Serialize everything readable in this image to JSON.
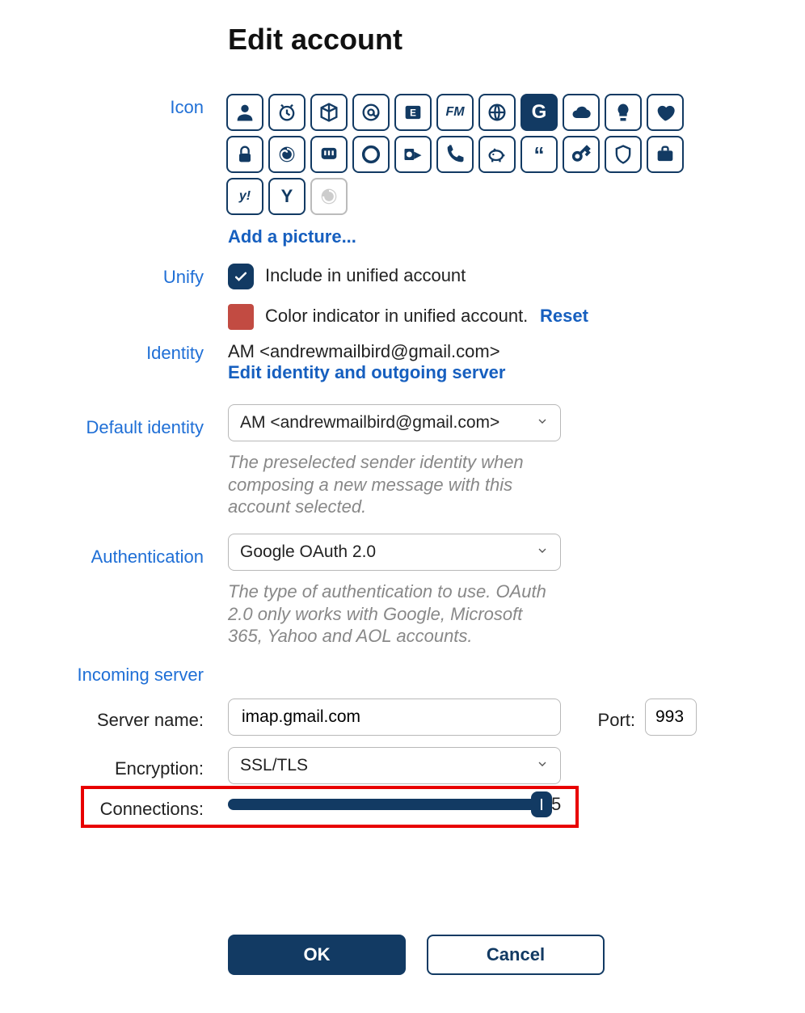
{
  "title": "Edit account",
  "labels": {
    "icon": "Icon",
    "unify": "Unify",
    "identity": "Identity",
    "defaultIdentity": "Default identity",
    "authentication": "Authentication",
    "incomingServer": "Incoming server",
    "serverName": "Server name:",
    "port": "Port:",
    "encryption": "Encryption:",
    "connections": "Connections:"
  },
  "iconPalette": {
    "addPicture": "Add a picture...",
    "selectedIndex": 8,
    "icons": [
      "person-icon",
      "clock-icon",
      "cube-icon",
      "at-icon",
      "exchange-icon",
      "fastmail-icon",
      "globe-icon",
      "google-icon",
      "google-icon-sel",
      "cloud-icon",
      "bulb-icon",
      "heart-icon",
      "lock-icon",
      "spiral-icon",
      "mastodon-icon",
      "circle-icon",
      "outlook-icon",
      "phone-icon",
      "piggy-icon",
      "quote-icon",
      "key-icon",
      "shield-icon",
      "briefcase-icon",
      "yahoo-icon",
      "y-icon",
      "disabled-icon"
    ]
  },
  "unify": {
    "checked": true,
    "includeLabel": "Include in unified account",
    "colorIndicator": "#c24b42",
    "colorLabel": "Color indicator in unified account.",
    "resetLabel": "Reset"
  },
  "identity": {
    "display": "AM <andrewmailbird@gmail.com>",
    "editLink": "Edit identity and outgoing server"
  },
  "defaultIdentity": {
    "value": "AM <andrewmailbird@gmail.com>",
    "hint": "The preselected sender identity when composing a new message with this account selected."
  },
  "authentication": {
    "value": "Google OAuth 2.0",
    "hint": "The type of authentication to use. OAuth 2.0 only works with Google, Microsoft 365, Yahoo and AOL accounts."
  },
  "incoming": {
    "serverName": "imap.gmail.com",
    "port": "993",
    "encryption": "SSL/TLS",
    "connectionsValue": "5",
    "connectionsPercent": 100
  },
  "buttons": {
    "ok": "OK",
    "cancel": "Cancel"
  }
}
